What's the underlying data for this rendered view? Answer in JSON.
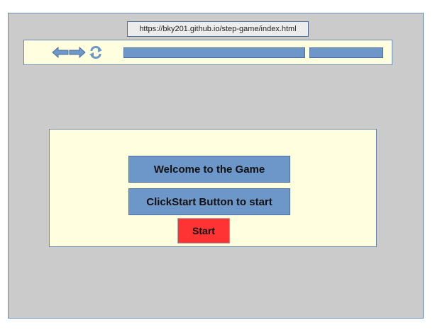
{
  "browser": {
    "url": "https://bky201.github.io/step-game/index.html",
    "icons": {
      "back": "back-arrow-icon",
      "forward": "forward-arrow-icon",
      "refresh": "refresh-icon"
    }
  },
  "game": {
    "welcome_text": "Welcome to the Game",
    "instruction_text": "ClickStart Button to start",
    "start_label": "Start"
  },
  "colors": {
    "frame_background": "#cbcbcb",
    "panel_background": "#ffffdf",
    "label_background": "#6d96c9",
    "start_button": "#ff3333",
    "border": "#6d8bb3"
  }
}
